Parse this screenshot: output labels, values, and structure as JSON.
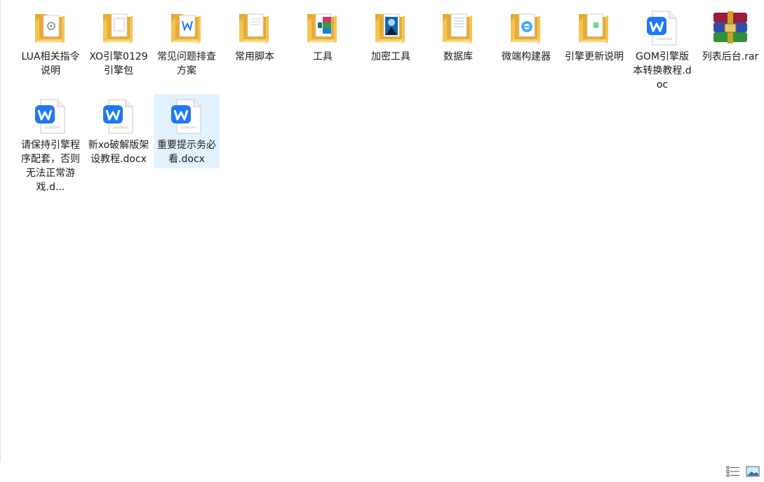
{
  "files": [
    {
      "name": "LUA相关指令说明",
      "type": "folder",
      "overlay": "gear-doc"
    },
    {
      "name": "XO引擎0129引擎包",
      "type": "folder",
      "overlay": "doc-page"
    },
    {
      "name": "常见问题排查方案",
      "type": "folder",
      "overlay": "wps-page"
    },
    {
      "name": "常用脚本",
      "type": "folder",
      "overlay": "text-page"
    },
    {
      "name": "工具",
      "type": "folder",
      "overlay": "colorful"
    },
    {
      "name": "加密工具",
      "type": "folder",
      "overlay": "blue-image"
    },
    {
      "name": "数据库",
      "type": "folder",
      "overlay": "spreadsheet"
    },
    {
      "name": "微端构建器",
      "type": "folder",
      "overlay": "ie-logo"
    },
    {
      "name": "引擎更新说明",
      "type": "folder",
      "overlay": "green-page"
    },
    {
      "name": "GOM引擎版本转换教程.doc",
      "type": "wps-doc"
    },
    {
      "name": "列表后台.rar",
      "type": "winrar-archive"
    },
    {
      "name": "请保持引擎程序配套，否则无法正常游戏.d...",
      "type": "wps-doc"
    },
    {
      "name": "新xo破解版架设教程.docx",
      "type": "wps-doc"
    },
    {
      "name": "重要提示务必看.docx",
      "type": "wps-doc",
      "selected": true
    }
  ],
  "colors": {
    "folder": "#f3c455",
    "folder_back": "#e6ac2f",
    "wps_blue": "#1e78f5",
    "selection": "#cce8ff"
  },
  "status_bar": {
    "details_view_icon": "details-view-icon",
    "large_icons_view_icon": "large-icons-view-icon"
  }
}
